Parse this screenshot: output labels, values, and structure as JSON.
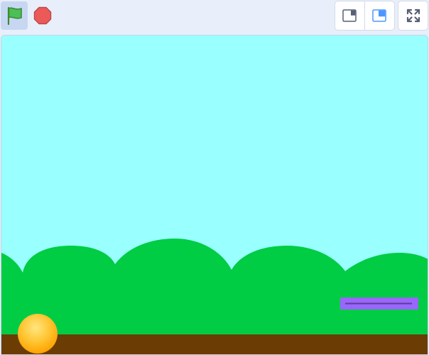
{
  "toolbar": {
    "green_flag": {
      "icon": "green-flag-icon",
      "active": true
    },
    "stop": {
      "icon": "stop-sign-icon"
    },
    "small_stage": {
      "icon": "small-stage-icon"
    },
    "normal_stage": {
      "icon": "normal-stage-icon",
      "selected": true
    },
    "fullscreen": {
      "icon": "fullscreen-icon"
    }
  },
  "stage": {
    "sky_color": "#99ffff",
    "hills_color": "#00cc44",
    "ground_color": "#6b3d05",
    "paddle_color": "#9966ff",
    "ball_color": "#ffb300"
  }
}
